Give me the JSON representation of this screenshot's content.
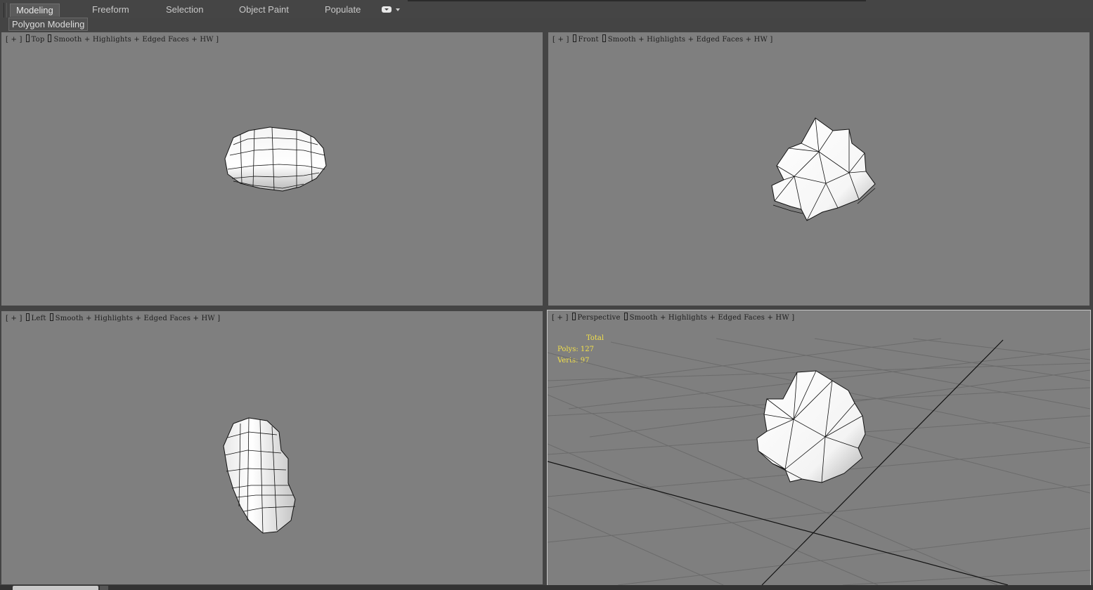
{
  "ribbon": {
    "tabs": [
      {
        "label": "Modeling",
        "active": true
      },
      {
        "label": "Freeform",
        "active": false
      },
      {
        "label": "Selection",
        "active": false
      },
      {
        "label": "Object Paint",
        "active": false
      },
      {
        "label": "Populate",
        "active": false
      }
    ],
    "menu_icon": "ribbon-options-icon"
  },
  "panel": {
    "label": "Polygon Modeling"
  },
  "viewports": {
    "top": {
      "plus": "[ + ]",
      "view": "Top",
      "shading": "Smooth + Highlights + Edged Faces + HW ]"
    },
    "front": {
      "plus": "[ + ]",
      "view": "Front",
      "shading": "Smooth + Highlights + Edged Faces + HW ]"
    },
    "left": {
      "plus": "[ + ]",
      "view": "Left",
      "shading": "Smooth + Highlights + Edged Faces + HW ]"
    },
    "perspective": {
      "plus": "[ + ]",
      "view": "Perspective",
      "shading": "Smooth + Highlights + Edged Faces + HW ]",
      "stats": {
        "header": "Total",
        "polys": "Polys: 127",
        "verts": "Verts: 97"
      }
    }
  },
  "colors": {
    "viewport_bg": "#7f7f7f",
    "ui_bg": "#444444",
    "stats_text": "#f2e04a",
    "active_border": "#c8c8c8"
  }
}
